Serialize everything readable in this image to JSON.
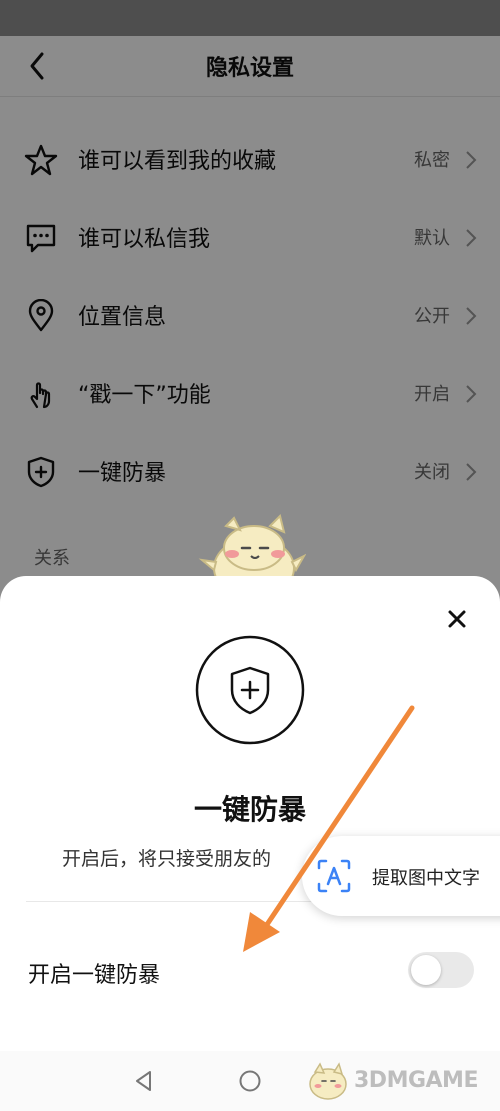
{
  "header": {
    "title": "隐私设置"
  },
  "settings": {
    "items": [
      {
        "label": "谁可以看到我的收藏",
        "value": "私密",
        "icon": "star-icon"
      },
      {
        "label": "谁可以私信我",
        "value": "默认",
        "icon": "message-icon"
      },
      {
        "label": "位置信息",
        "value": "公开",
        "icon": "location-pin-icon"
      },
      {
        "label": "“戳一下”功能",
        "value": "开启",
        "icon": "tap-hand-icon"
      },
      {
        "label": "一键防暴",
        "value": "关闭",
        "icon": "shield-plus-icon"
      }
    ],
    "section_label": "关系"
  },
  "sheet": {
    "title": "一键防暴",
    "description": "开启后，将只接受朋友的",
    "toggle_label": "开启一键防暴",
    "toggle_on": false
  },
  "ocr": {
    "label": "提取图中文字"
  },
  "watermark": {
    "text": "3DMGAME"
  },
  "colors": {
    "arrow": "#f0883a",
    "overlay": "rgba(0,0,0,0.45)",
    "toggle_off": "#e9e9e9"
  }
}
